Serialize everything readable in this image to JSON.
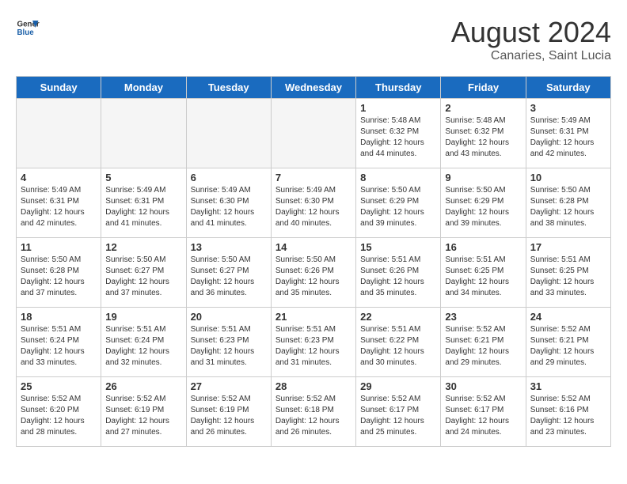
{
  "logo": {
    "line1": "General",
    "line2": "Blue"
  },
  "title": "August 2024",
  "subtitle": "Canaries, Saint Lucia",
  "days_header": [
    "Sunday",
    "Monday",
    "Tuesday",
    "Wednesday",
    "Thursday",
    "Friday",
    "Saturday"
  ],
  "weeks": [
    [
      {
        "day": "",
        "info": ""
      },
      {
        "day": "",
        "info": ""
      },
      {
        "day": "",
        "info": ""
      },
      {
        "day": "",
        "info": ""
      },
      {
        "day": "1",
        "info": "Sunrise: 5:48 AM\nSunset: 6:32 PM\nDaylight: 12 hours\nand 44 minutes."
      },
      {
        "day": "2",
        "info": "Sunrise: 5:48 AM\nSunset: 6:32 PM\nDaylight: 12 hours\nand 43 minutes."
      },
      {
        "day": "3",
        "info": "Sunrise: 5:49 AM\nSunset: 6:31 PM\nDaylight: 12 hours\nand 42 minutes."
      }
    ],
    [
      {
        "day": "4",
        "info": "Sunrise: 5:49 AM\nSunset: 6:31 PM\nDaylight: 12 hours\nand 42 minutes."
      },
      {
        "day": "5",
        "info": "Sunrise: 5:49 AM\nSunset: 6:31 PM\nDaylight: 12 hours\nand 41 minutes."
      },
      {
        "day": "6",
        "info": "Sunrise: 5:49 AM\nSunset: 6:30 PM\nDaylight: 12 hours\nand 41 minutes."
      },
      {
        "day": "7",
        "info": "Sunrise: 5:49 AM\nSunset: 6:30 PM\nDaylight: 12 hours\nand 40 minutes."
      },
      {
        "day": "8",
        "info": "Sunrise: 5:50 AM\nSunset: 6:29 PM\nDaylight: 12 hours\nand 39 minutes."
      },
      {
        "day": "9",
        "info": "Sunrise: 5:50 AM\nSunset: 6:29 PM\nDaylight: 12 hours\nand 39 minutes."
      },
      {
        "day": "10",
        "info": "Sunrise: 5:50 AM\nSunset: 6:28 PM\nDaylight: 12 hours\nand 38 minutes."
      }
    ],
    [
      {
        "day": "11",
        "info": "Sunrise: 5:50 AM\nSunset: 6:28 PM\nDaylight: 12 hours\nand 37 minutes."
      },
      {
        "day": "12",
        "info": "Sunrise: 5:50 AM\nSunset: 6:27 PM\nDaylight: 12 hours\nand 37 minutes."
      },
      {
        "day": "13",
        "info": "Sunrise: 5:50 AM\nSunset: 6:27 PM\nDaylight: 12 hours\nand 36 minutes."
      },
      {
        "day": "14",
        "info": "Sunrise: 5:50 AM\nSunset: 6:26 PM\nDaylight: 12 hours\nand 35 minutes."
      },
      {
        "day": "15",
        "info": "Sunrise: 5:51 AM\nSunset: 6:26 PM\nDaylight: 12 hours\nand 35 minutes."
      },
      {
        "day": "16",
        "info": "Sunrise: 5:51 AM\nSunset: 6:25 PM\nDaylight: 12 hours\nand 34 minutes."
      },
      {
        "day": "17",
        "info": "Sunrise: 5:51 AM\nSunset: 6:25 PM\nDaylight: 12 hours\nand 33 minutes."
      }
    ],
    [
      {
        "day": "18",
        "info": "Sunrise: 5:51 AM\nSunset: 6:24 PM\nDaylight: 12 hours\nand 33 minutes."
      },
      {
        "day": "19",
        "info": "Sunrise: 5:51 AM\nSunset: 6:24 PM\nDaylight: 12 hours\nand 32 minutes."
      },
      {
        "day": "20",
        "info": "Sunrise: 5:51 AM\nSunset: 6:23 PM\nDaylight: 12 hours\nand 31 minutes."
      },
      {
        "day": "21",
        "info": "Sunrise: 5:51 AM\nSunset: 6:23 PM\nDaylight: 12 hours\nand 31 minutes."
      },
      {
        "day": "22",
        "info": "Sunrise: 5:51 AM\nSunset: 6:22 PM\nDaylight: 12 hours\nand 30 minutes."
      },
      {
        "day": "23",
        "info": "Sunrise: 5:52 AM\nSunset: 6:21 PM\nDaylight: 12 hours\nand 29 minutes."
      },
      {
        "day": "24",
        "info": "Sunrise: 5:52 AM\nSunset: 6:21 PM\nDaylight: 12 hours\nand 29 minutes."
      }
    ],
    [
      {
        "day": "25",
        "info": "Sunrise: 5:52 AM\nSunset: 6:20 PM\nDaylight: 12 hours\nand 28 minutes."
      },
      {
        "day": "26",
        "info": "Sunrise: 5:52 AM\nSunset: 6:19 PM\nDaylight: 12 hours\nand 27 minutes."
      },
      {
        "day": "27",
        "info": "Sunrise: 5:52 AM\nSunset: 6:19 PM\nDaylight: 12 hours\nand 26 minutes."
      },
      {
        "day": "28",
        "info": "Sunrise: 5:52 AM\nSunset: 6:18 PM\nDaylight: 12 hours\nand 26 minutes."
      },
      {
        "day": "29",
        "info": "Sunrise: 5:52 AM\nSunset: 6:17 PM\nDaylight: 12 hours\nand 25 minutes."
      },
      {
        "day": "30",
        "info": "Sunrise: 5:52 AM\nSunset: 6:17 PM\nDaylight: 12 hours\nand 24 minutes."
      },
      {
        "day": "31",
        "info": "Sunrise: 5:52 AM\nSunset: 6:16 PM\nDaylight: 12 hours\nand 23 minutes."
      }
    ]
  ]
}
